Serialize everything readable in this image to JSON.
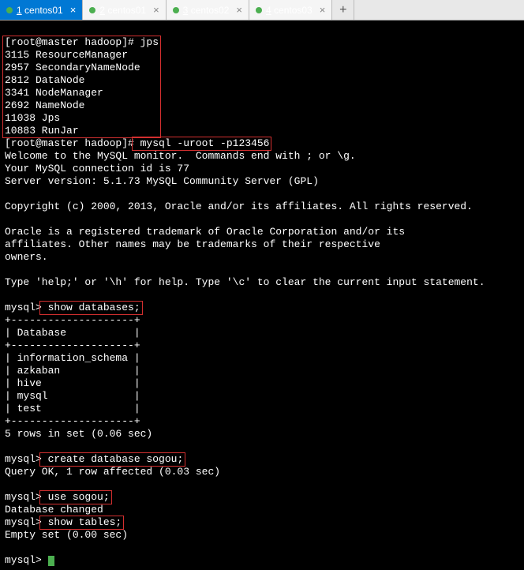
{
  "tabs": [
    {
      "num": "1",
      "label": "centos01",
      "active": true
    },
    {
      "num": "2",
      "label": "centos01",
      "active": false
    },
    {
      "num": "3",
      "label": "centos02",
      "active": false
    },
    {
      "num": "4",
      "label": "centos03",
      "active": false
    }
  ],
  "lines": {
    "prompt1_host": "[root@master hadoop]#",
    "cmd_jps": " jps",
    "jps_out": [
      "3115 ResourceManager",
      "2957 SecondaryNameNode",
      "2812 DataNode",
      "3341 NodeManager",
      "2692 NameNode",
      "11038 Jps",
      "10883 RunJar"
    ],
    "prompt2_host": "[root@master hadoop]#",
    "cmd_mysql": " mysql -uroot -p123456",
    "mysql_welcome": [
      "Welcome to the MySQL monitor.  Commands end with ; or \\g.",
      "Your MySQL connection id is 77",
      "Server version: 5.1.73 MySQL Community Server (GPL)",
      "",
      "Copyright (c) 2000, 2013, Oracle and/or its affiliates. All rights reserved.",
      "",
      "Oracle is a registered trademark of Oracle Corporation and/or its",
      "affiliates. Other names may be trademarks of their respective",
      "owners.",
      "",
      "Type 'help;' or '\\h' for help. Type '\\c' to clear the current input statement.",
      ""
    ],
    "mysql_prompt": "mysql>",
    "cmd_show_db": " show databases;",
    "db_table": [
      "+--------------------+",
      "| Database           |",
      "+--------------------+",
      "| information_schema |",
      "| azkaban            |",
      "| hive               |",
      "| mysql              |",
      "| test               |",
      "+--------------------+"
    ],
    "db_rows_msg": "5 rows in set (0.06 sec)",
    "cmd_create": " create database sogou;",
    "create_msg": "Query OK, 1 row affected (0.03 sec)",
    "cmd_use": " use sogou;",
    "use_msg": "Database changed",
    "cmd_show_tables": " show tables;",
    "tables_msg": "Empty set (0.00 sec)"
  }
}
